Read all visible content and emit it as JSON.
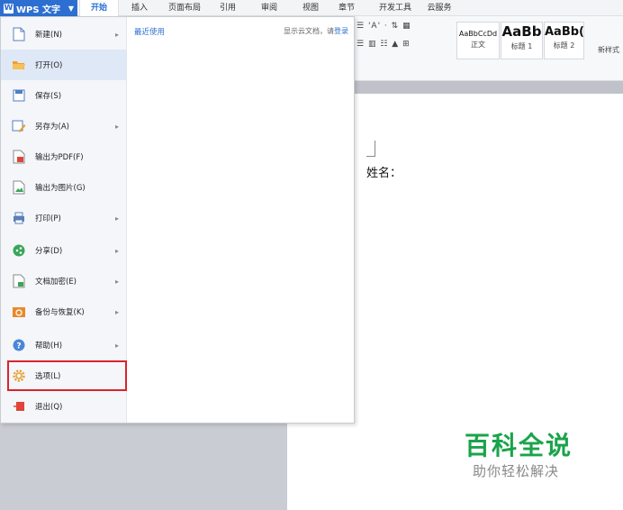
{
  "app": {
    "name": "WPS 文字"
  },
  "tabs": [
    {
      "label": "开始",
      "active": true
    },
    {
      "label": "插入"
    },
    {
      "label": "页面布局"
    },
    {
      "label": "引用"
    },
    {
      "label": "审阅"
    },
    {
      "label": "视图"
    },
    {
      "label": "章节"
    },
    {
      "label": "开发工具"
    },
    {
      "label": "云服务"
    }
  ],
  "ribbon": {
    "font_size_buttons": "'A' ·",
    "styles": [
      {
        "sample": "AaBbCcDd",
        "caption": "正文"
      },
      {
        "sample": "AaBb",
        "caption": "标题 1"
      },
      {
        "sample": "AaBb(",
        "caption": "标题 2"
      }
    ],
    "new_style_label": "新样式"
  },
  "file_menu": {
    "items": [
      {
        "label": "新建(N)",
        "icon": "new-doc-icon",
        "submenu": true
      },
      {
        "label": "打开(O)",
        "icon": "folder-open-icon",
        "submenu": false,
        "hover": true
      },
      {
        "label": "保存(S)",
        "icon": "save-icon",
        "submenu": false
      },
      {
        "label": "另存为(A)",
        "icon": "save-as-icon",
        "submenu": true
      },
      {
        "label": "输出为PDF(F)",
        "icon": "pdf-icon",
        "submenu": false
      },
      {
        "label": "输出为图片(G)",
        "icon": "image-export-icon",
        "submenu": false
      },
      {
        "label": "打印(P)",
        "icon": "printer-icon",
        "submenu": true
      },
      {
        "label": "分享(D)",
        "icon": "share-icon",
        "submenu": true
      },
      {
        "label": "文档加密(E)",
        "icon": "encrypt-icon",
        "submenu": true
      },
      {
        "label": "备份与恢复(K)",
        "icon": "backup-icon",
        "submenu": true
      },
      {
        "label": "帮助(H)",
        "icon": "help-icon",
        "submenu": true
      },
      {
        "label": "选项(L)",
        "icon": "gear-icon",
        "submenu": false,
        "highlight": true
      },
      {
        "label": "退出(Q)",
        "icon": "exit-icon",
        "submenu": false
      }
    ],
    "recent_label": "最近使用",
    "cloud_hint": "显示云文档，请",
    "cloud_login": "登录"
  },
  "document": {
    "text": "姓名："
  },
  "watermark": {
    "title": "百科全说",
    "subtitle": "助你轻松解决"
  },
  "colors": {
    "accent": "#2d6fd0",
    "highlight_border": "#d9242b",
    "watermark_green": "#1aa34a"
  }
}
